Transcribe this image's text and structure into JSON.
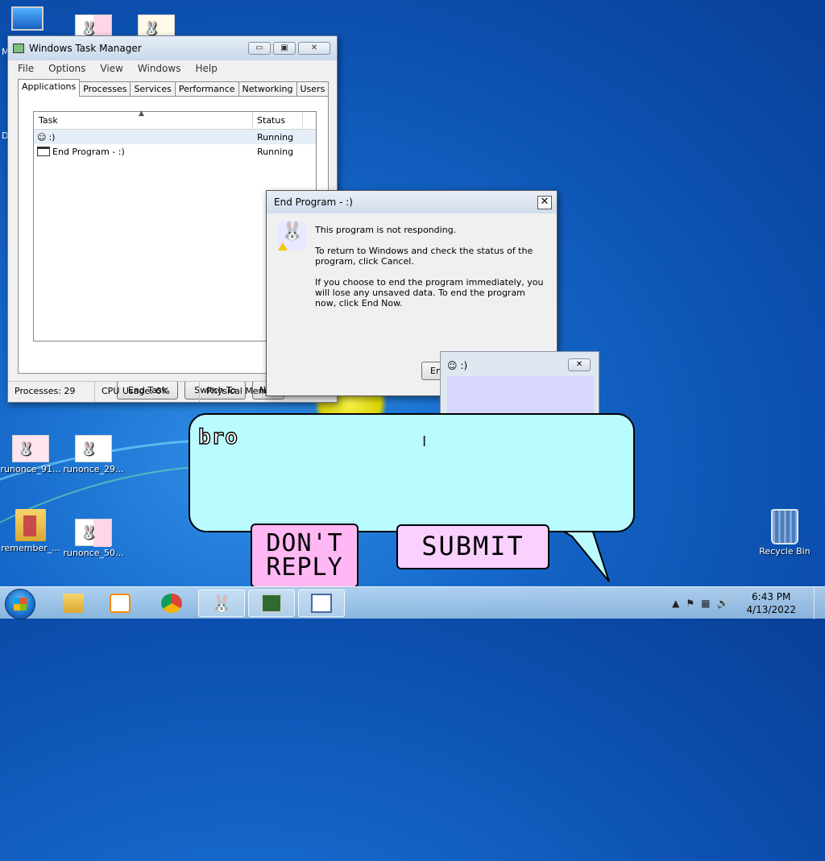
{
  "desktop": {
    "icons": [
      {
        "label": "runonce_91..."
      },
      {
        "label": "runonce_29..."
      },
      {
        "label": "remember_..."
      },
      {
        "label": "runonce_50..."
      },
      {
        "label": "Recycle Bin"
      }
    ],
    "edge_letters": [
      "M",
      "D"
    ]
  },
  "task_manager": {
    "title": "Windows Task Manager",
    "menu": [
      "File",
      "Options",
      "View",
      "Windows",
      "Help"
    ],
    "tabs": [
      "Applications",
      "Processes",
      "Services",
      "Performance",
      "Networking",
      "Users"
    ],
    "active_tab": "Applications",
    "columns": {
      "task": "Task",
      "status": "Status"
    },
    "rows": [
      {
        "task": ":)",
        "status": "Running"
      },
      {
        "task": "End Program - :)",
        "status": "Running"
      }
    ],
    "buttons": {
      "end_task": "End Task",
      "switch_to": "Switch To",
      "new_task": "N"
    },
    "status_bar": {
      "processes": "Processes: 29",
      "cpu": "CPU Usage: 0%",
      "memory": "Physical Mem"
    },
    "caption": {
      "minimize": "▭",
      "maximize": "▣",
      "close": "✕"
    }
  },
  "end_program_dialog": {
    "title": "End Program - :)",
    "close": "✕",
    "message1": "This program is not responding.",
    "message2": "To return to Windows and check the status of the program, click Cancel.",
    "message3": "If you choose to end the program immediately, you will lose any unsaved data. To end the program now, click End Now.",
    "button_partial": "En"
  },
  "smile_window": {
    "title": ":)",
    "close": "✕"
  },
  "chat": {
    "message": "bro",
    "dont_reply": "DON'T REPLY",
    "submit": "SUBMIT"
  },
  "taskbar": {
    "time": "6:43 PM",
    "date": "4/13/2022",
    "tray_chevron": "▲"
  }
}
